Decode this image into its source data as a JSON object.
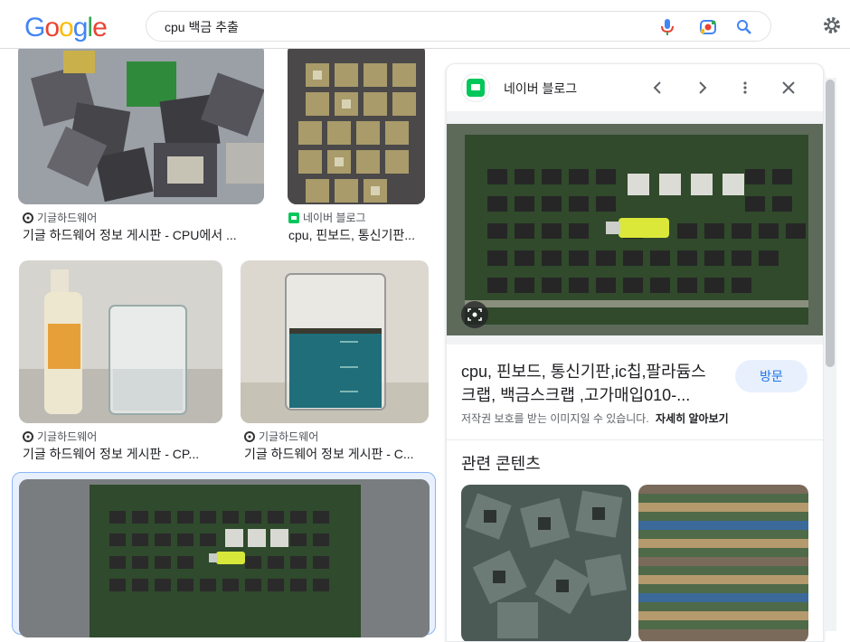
{
  "search": {
    "query": "cpu 백금 추출"
  },
  "results": [
    {
      "source": "기글하드웨어",
      "title": "기글 하드웨어 정보 게시판 - CPU에서 ..."
    },
    {
      "source": "네이버 블로그",
      "title": "cpu, 핀보드, 통신기판..."
    },
    {
      "source": "기글하드웨어",
      "title": "기글 하드웨어 정보 게시판 - CP..."
    },
    {
      "source": "기글하드웨어",
      "title": "기글 하드웨어 정보 게시판 - C..."
    }
  ],
  "panel": {
    "source": "네이버 블로그",
    "title": "cpu, 핀보드, 통신기판,ic칩,팔라듐스크랩, 백금스크랩 ,고가매입010-...",
    "visit_label": "방문",
    "copyright_note": "저작권 보호를 받는 이미지일 수 있습니다.",
    "learn_more": "자세히 알아보기",
    "related_heading": "관련 콘텐츠"
  },
  "colors": {
    "accent": "#1a73e8",
    "visit_bg": "#e8f0fe",
    "naver_green": "#03c75a"
  },
  "icons": [
    "mic-icon",
    "lens-icon",
    "search-icon",
    "gear-icon",
    "chevron-left-icon",
    "chevron-right-icon",
    "more-vert-icon",
    "close-icon",
    "lens-scan-icon"
  ]
}
